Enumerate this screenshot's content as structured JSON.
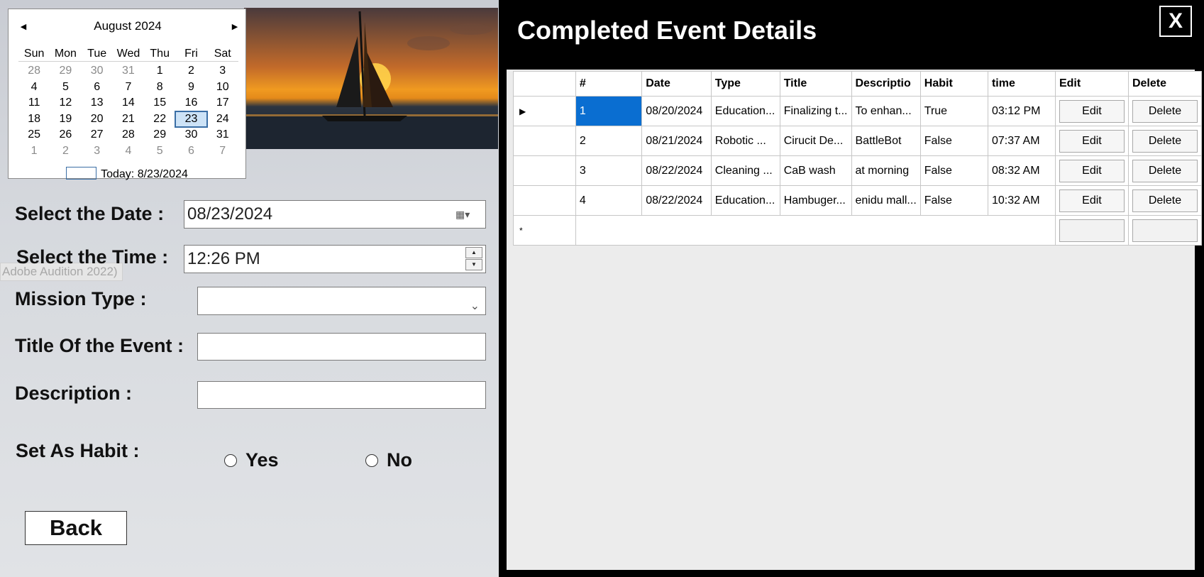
{
  "calendar": {
    "month_title": "August 2024",
    "prev_arrow": "◀",
    "next_arrow": "▶",
    "weekdays": [
      "Sun",
      "Mon",
      "Tue",
      "Wed",
      "Thu",
      "Fri",
      "Sat"
    ],
    "weeks": [
      [
        "28",
        "29",
        "30",
        "31",
        "1",
        "2",
        "3"
      ],
      [
        "4",
        "5",
        "6",
        "7",
        "8",
        "9",
        "10"
      ],
      [
        "11",
        "12",
        "13",
        "14",
        "15",
        "16",
        "17"
      ],
      [
        "18",
        "19",
        "20",
        "21",
        "22",
        "23",
        "24"
      ],
      [
        "25",
        "26",
        "27",
        "28",
        "29",
        "30",
        "31"
      ],
      [
        "1",
        "2",
        "3",
        "4",
        "5",
        "6",
        "7"
      ]
    ],
    "selected_day": "23",
    "today_label": "Today: 8/23/2024"
  },
  "form": {
    "date_label": "Select the Date :",
    "date_value": "08/23/2024",
    "time_label": "Select the Time :",
    "time_value": "12:26 PM",
    "ghost_hint": "Adobe Audition 2022)",
    "mission_type_label": "Mission Type :",
    "mission_type_value": "",
    "title_label": "Title Of the Event :",
    "title_value": "",
    "description_label": "Description :",
    "description_value": "",
    "habit_label": "Set As Habit :",
    "habit_yes": "Yes",
    "habit_no": "No",
    "back_label": "Back"
  },
  "details": {
    "title": "Completed Event Details",
    "close_label": "X",
    "columns": [
      "#",
      "Date",
      "Type",
      "Title",
      "Descriptio",
      "Habit",
      "time",
      "Edit",
      "Delete"
    ],
    "rows": [
      {
        "num": "1",
        "date": "08/20/2024",
        "type": "Education...",
        "title": "Finalizing t...",
        "desc": "To enhan...",
        "habit": "True",
        "time": "03:12 PM",
        "edit": "Edit",
        "delete": "Delete"
      },
      {
        "num": "2",
        "date": "08/21/2024",
        "type": "Robotic ...",
        "title": "Cirucit De...",
        "desc": "BattleBot",
        "habit": "False",
        "time": "07:37 AM",
        "edit": "Edit",
        "delete": "Delete"
      },
      {
        "num": "3",
        "date": "08/22/2024",
        "type": "Cleaning ...",
        "title": "CaB wash",
        "desc": "at morning",
        "habit": "False",
        "time": "08:32 AM",
        "edit": "Edit",
        "delete": "Delete"
      },
      {
        "num": "4",
        "date": "08/22/2024",
        "type": "Education...",
        "title": "Hambuger...",
        "desc": "enidu mall...",
        "habit": "False",
        "time": "10:32 AM",
        "edit": "Edit",
        "delete": "Delete"
      }
    ],
    "current_row_marker": "▶",
    "new_row_marker": "*"
  }
}
